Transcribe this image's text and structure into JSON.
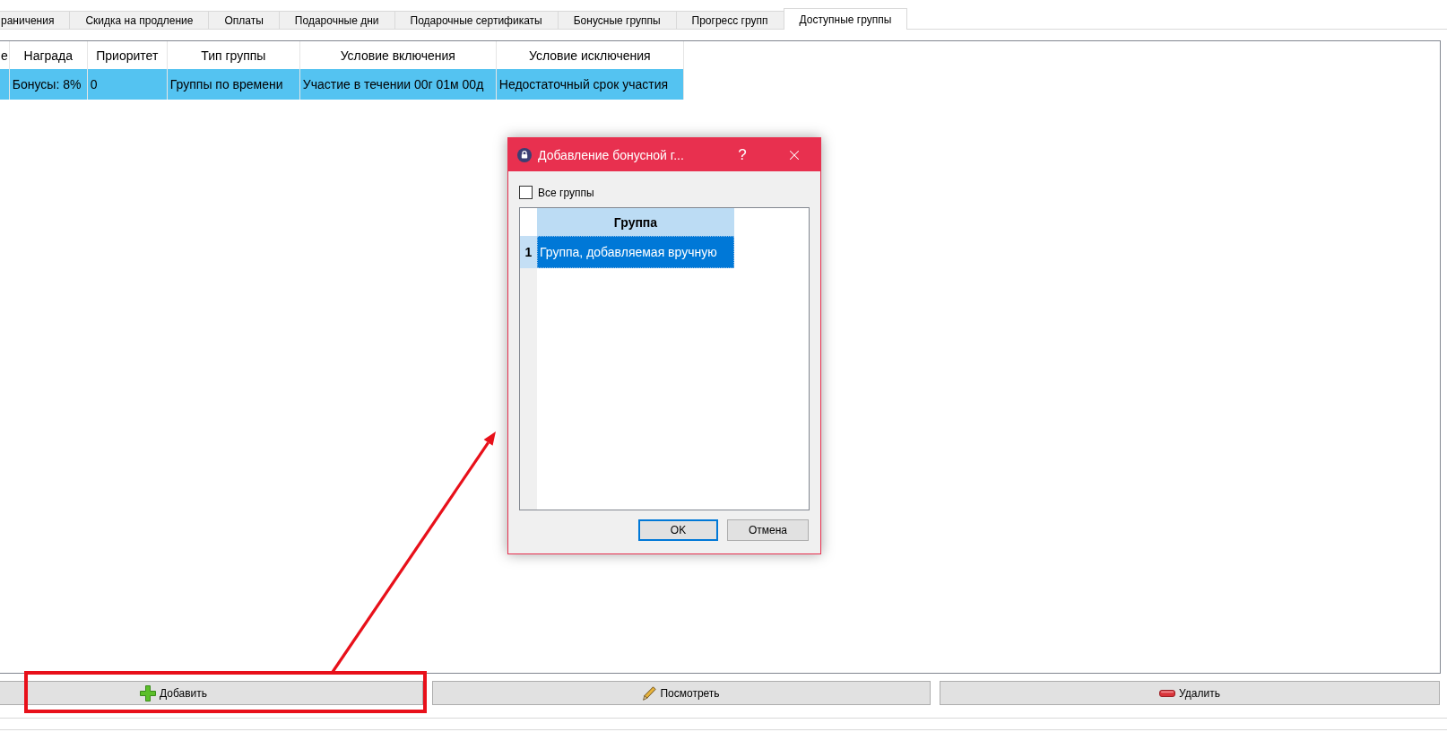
{
  "tabs": [
    {
      "label": "раничения",
      "selected": false
    },
    {
      "label": "Скидка на продление",
      "selected": false
    },
    {
      "label": "Оплаты",
      "selected": false
    },
    {
      "label": "Подарочные дни",
      "selected": false
    },
    {
      "label": "Подарочные сертификаты",
      "selected": false
    },
    {
      "label": "Бонусные группы",
      "selected": false
    },
    {
      "label": "Прогресс групп",
      "selected": false
    },
    {
      "label": "Доступные группы",
      "selected": true
    }
  ],
  "table": {
    "columns": [
      "е",
      "Награда",
      "Приоритет",
      "Тип группы",
      "Условие включения",
      "Условие исключения"
    ],
    "rows": [
      {
        "selected": true,
        "cells": [
          "",
          "Бонусы: 8%",
          "0",
          "Группы по времени",
          "Участие в течении 00г 01м 00д",
          "Недостаточный срок участия"
        ]
      }
    ]
  },
  "buttons": [
    {
      "kind": "add",
      "label": "Добавить",
      "highlighted": true
    },
    {
      "kind": "view",
      "label": "Посмотреть",
      "highlighted": false
    },
    {
      "kind": "delete",
      "label": "Удалить",
      "highlighted": false
    }
  ],
  "dialog": {
    "title": "Добавление бонусной г...",
    "help": "?",
    "all_groups": {
      "label": "Все группы",
      "checked": false
    },
    "table": {
      "columns": [
        "Группа"
      ],
      "rows": [
        {
          "number": "1",
          "selected": true,
          "cells": [
            "Группа, добавляемая вручную"
          ]
        }
      ]
    },
    "buttons": [
      {
        "label": "OK",
        "default": true
      },
      {
        "label": "Отмена",
        "default": false
      }
    ]
  }
}
